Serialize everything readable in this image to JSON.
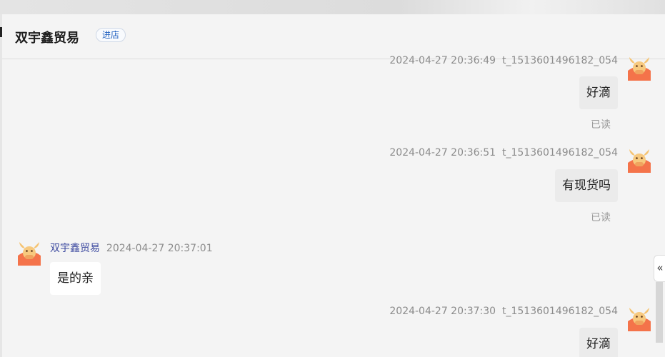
{
  "header": {
    "shop_name": "双宇鑫贸易",
    "enter_shop_label": "进店"
  },
  "messages": [
    {
      "direction": "out",
      "timestamp": "2024-04-27 20:36:49",
      "user": "t_1513601496182_054",
      "text": "好滴",
      "status": "已读"
    },
    {
      "direction": "out",
      "timestamp": "2024-04-27 20:36:51",
      "user": "t_1513601496182_054",
      "text": "有现货吗",
      "status": "已读"
    },
    {
      "direction": "in",
      "sender": "双宇鑫贸易",
      "timestamp": "2024-04-27 20:37:01",
      "text": "是的亲"
    },
    {
      "direction": "out",
      "timestamp": "2024-04-27 20:37:30",
      "user": "t_1513601496182_054",
      "text": "好滴"
    }
  ],
  "collapse_icon": "«",
  "icons": {
    "avatar": "bull-avatar-icon",
    "collapse": "double-chevron-left-icon"
  },
  "colors": {
    "link": "#3d4aa0",
    "enter_button_text": "#1f5fbf",
    "avatar_orange": "#f4734a"
  }
}
